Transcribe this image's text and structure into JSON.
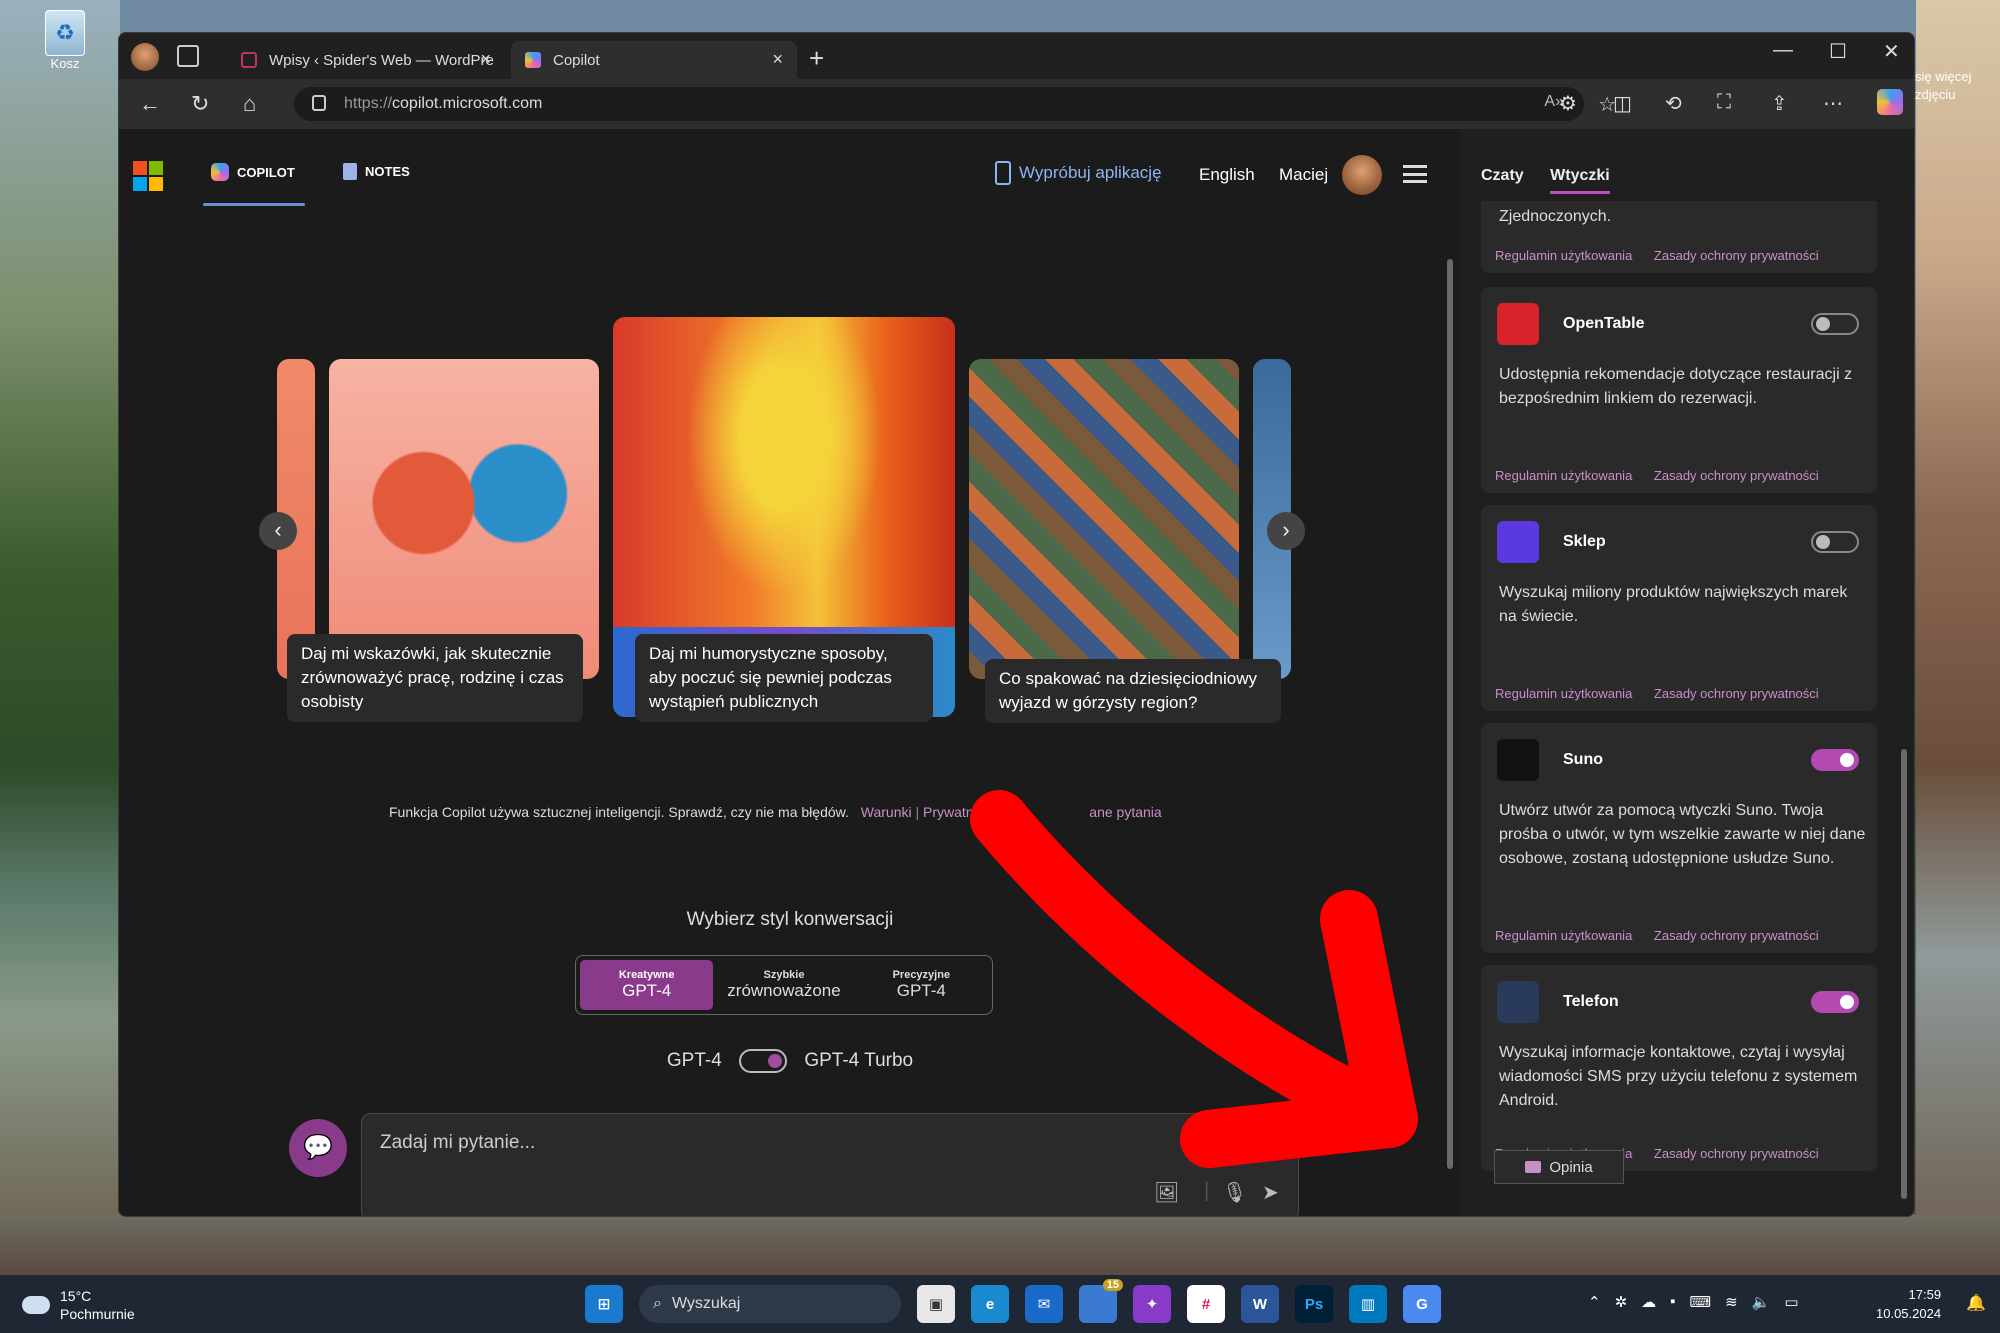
{
  "desktop": {
    "recycle_label": "Kosz",
    "side_text_1": "się więcej",
    "side_text_2": "zdjęciu"
  },
  "browser": {
    "tabs": [
      {
        "title": "Wpisy ‹ Spider's Web — WordPre"
      },
      {
        "title": "Copilot"
      }
    ],
    "url_proto": "https://",
    "url_host": "copilot.microsoft.com",
    "win_min": "—",
    "win_max": "☐",
    "win_close": "✕"
  },
  "header": {
    "tab_copilot": "COPILOT",
    "tab_notes": "NOTES",
    "try_app": "Wypróbuj aplikację",
    "language": "English",
    "user_name": "Maciej"
  },
  "carousel": {
    "captions": [
      "Daj mi wskazówki, jak skutecznie zrównoważyć pracę, rodzinę i czas osobisty",
      "Daj mi humorystyczne sposoby, aby poczuć się pewniej podczas wystąpień publicznych",
      "Co spakować na dziesięciodniowy wyjazd w górzysty region?"
    ]
  },
  "disclaimer": {
    "text": "Funkcja Copilot używa sztucznej inteligencji. Sprawdź, czy nie ma błędów.",
    "link_terms": "Warunki",
    "link_privacy": "Prywatność",
    "link_faq": "ane pytania"
  },
  "style": {
    "title": "Wybierz styl konwersacji",
    "options": [
      {
        "top": "Kreatywne",
        "bottom": "GPT-4"
      },
      {
        "top": "Szybkie",
        "bottom": "zrównoważone"
      },
      {
        "top": "Precyzyjne",
        "bottom": "GPT-4"
      }
    ],
    "gpt_left": "GPT-4",
    "gpt_right": "GPT-4 Turbo"
  },
  "chat": {
    "placeholder": "Zadaj mi pytanie..."
  },
  "sidebar": {
    "tab_chats": "Czaty",
    "tab_plugins": "Wtyczki",
    "top_fragment": "Zjednoczonych.",
    "link_terms": "Regulamin użytkowania",
    "link_privacy": "Zasady ochrony prywatności",
    "plugins": [
      {
        "name": "OpenTable",
        "desc": "Udostępnia rekomendacje dotyczące restauracji z bezpośrednim linkiem do rezerwacji.",
        "enabled": false,
        "color": "#d8232a"
      },
      {
        "name": "Sklep",
        "desc": "Wyszukaj miliony produktów największych marek na świecie.",
        "enabled": false,
        "color": "#5a3ae0"
      },
      {
        "name": "Suno",
        "desc": "Utwórz utwór za pomocą wtyczki Suno. Twoja prośba o utwór, w tym wszelkie zawarte w niej dane osobowe, zostaną udostępnione usłudze Suno.",
        "enabled": true,
        "color": "#111111"
      },
      {
        "name": "Telefon",
        "desc": "Wyszukaj informacje kontaktowe, czytaj i wysyłaj wiadomości SMS przy użyciu telefonu z systemem Android.",
        "enabled": true,
        "color": "#2a3a5a"
      }
    ],
    "feedback": "Opinia"
  },
  "taskbar": {
    "temp": "15°C",
    "weather": "Pochmurnie",
    "search": "Wyszukaj",
    "badge_store": "15",
    "time": "17:59",
    "date": "10.05.2024"
  }
}
